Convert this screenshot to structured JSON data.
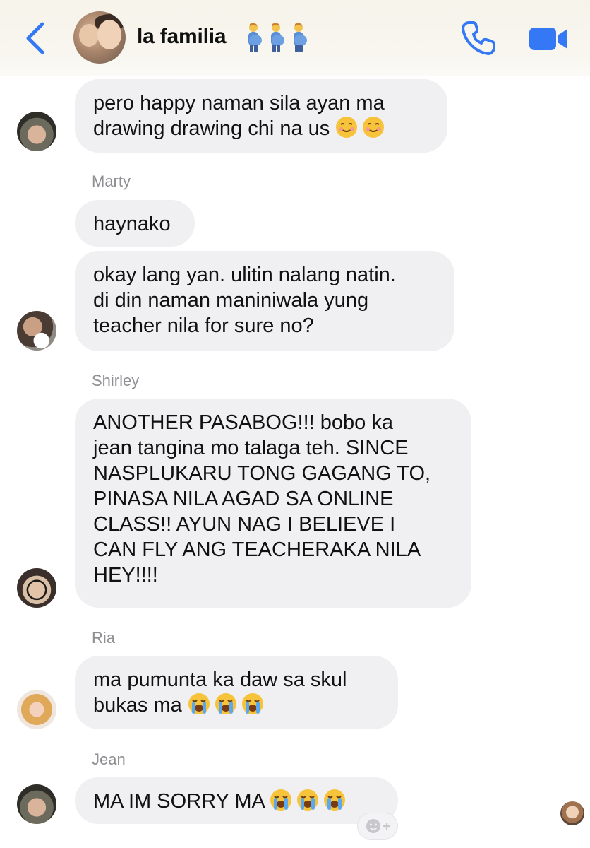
{
  "header": {
    "title": "la familia",
    "title_emojis": [
      "pregnant-man-emoji",
      "pregnant-man-emoji",
      "pregnant-man-emoji"
    ],
    "icons": {
      "back": "chevron-left-icon",
      "call": "phone-icon",
      "video": "video-camera-icon"
    },
    "accent_color": "#3478f6"
  },
  "messages": [
    {
      "sender": "",
      "lines": [
        "pero happy naman sila ayan ma",
        "drawing drawing chi na us"
      ],
      "trailing_emojis": [
        "smiling-face-emoji",
        "smiling-face-emoji"
      ]
    },
    {
      "sender": "Marty",
      "lines": [
        "haynako"
      ],
      "trailing_emojis": []
    },
    {
      "sender": "",
      "lines": [
        "okay lang yan. ulitin nalang natin.",
        "di din naman maniniwala yung",
        "teacher nila for sure no?"
      ],
      "trailing_emojis": []
    },
    {
      "sender": "Shirley",
      "lines": [
        "ANOTHER PASABOG!!! bobo ka",
        "jean tangina mo talaga teh. SINCE",
        "NASPLUKARU TONG GAGANG TO,",
        "PINASA NILA AGAD SA ONLINE",
        "CLASS!! AYUN NAG I BELIEVE I",
        "CAN FLY ANG TEACHERAKA NILA",
        "HEY!!!!"
      ],
      "trailing_emojis": []
    },
    {
      "sender": "Ria",
      "lines": [
        "ma pumunta ka daw sa skul",
        "bukas ma"
      ],
      "trailing_emojis": [
        "loudly-crying-face-emoji",
        "loudly-crying-face-emoji",
        "loudly-crying-face-emoji"
      ]
    },
    {
      "sender": "Jean",
      "lines": [
        "MA IM SORRY MA"
      ],
      "trailing_emojis": [
        "loudly-crying-face-emoji",
        "loudly-crying-face-emoji",
        "loudly-crying-face-emoji"
      ]
    }
  ],
  "footer": {
    "reaction_icon": "add-reaction-icon"
  }
}
